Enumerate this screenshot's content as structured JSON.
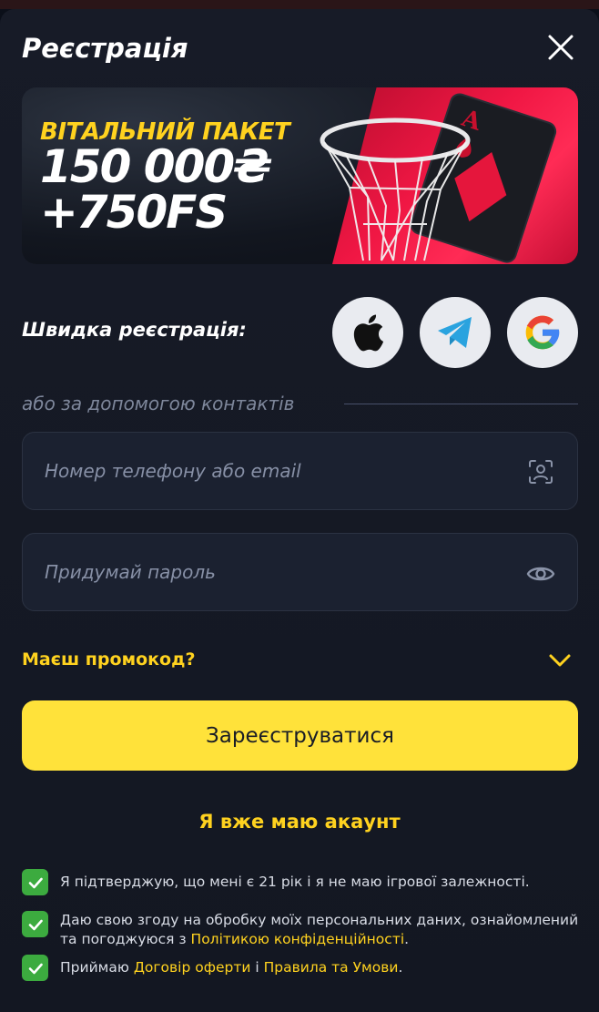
{
  "modal": {
    "title": "Реєстрація",
    "close_icon": "close-icon"
  },
  "banner": {
    "line1": "ВІТАЛЬНИЙ ПАКЕТ",
    "line2": "150 000₴",
    "line3": "+750FS",
    "art_icon": "basketball-hoop-and-playing-card-art"
  },
  "quick_registration": {
    "label": "Швидка реєстрація:",
    "providers": [
      {
        "name": "Apple",
        "icon": "apple-icon"
      },
      {
        "name": "Telegram",
        "icon": "telegram-icon"
      },
      {
        "name": "Google",
        "icon": "google-icon"
      }
    ]
  },
  "divider": {
    "text": "або за допомогою контактів"
  },
  "form": {
    "contact_placeholder": "Номер телефону або email",
    "contact_value": "",
    "contact_icon": "contact-scan-icon",
    "password_placeholder": "Придумай пароль",
    "password_value": "",
    "password_icon": "eye-icon"
  },
  "promo": {
    "label": "Маєш промокод?",
    "icon": "chevron-down-icon"
  },
  "submit_label": "Зареєструватися",
  "login_link": "Я вже маю акаунт",
  "agreements": [
    {
      "checked": true,
      "text_before": "Я підтверджую, що мені є 21 рік і я не маю ігрової залежності.",
      "link1": "",
      "text_between": "",
      "link2": "",
      "text_after": ""
    },
    {
      "checked": true,
      "text_before": "Даю свою згоду на обробку моїх персональних даних, ознайомлений та погоджуюся з ",
      "link1": "Політикою конфіденційності",
      "text_between": "",
      "link2": "",
      "text_after": "."
    },
    {
      "checked": true,
      "text_before": "Приймаю ",
      "link1": "Договір оферти",
      "text_between": " і ",
      "link2": "Правила та Умови",
      "text_after": "."
    }
  ],
  "colors": {
    "accent": "#ffe23a",
    "link": "#ffd21f",
    "background": "#171b27",
    "field": "#1b2130",
    "check": "#3cab3f",
    "banner_red": "#f01744"
  }
}
